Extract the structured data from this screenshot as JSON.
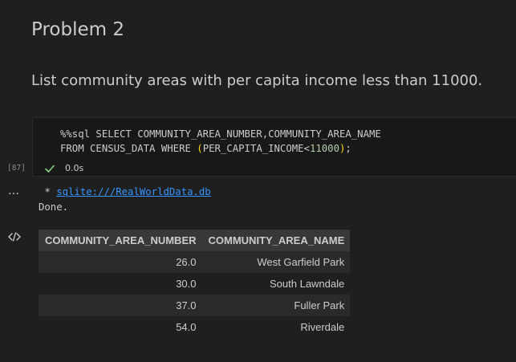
{
  "markdown": {
    "heading": "Problem 2",
    "paragraph": "List community areas with per capita income less than 11000."
  },
  "code_cell": {
    "line1": "%%sql SELECT COMMUNITY_AREA_NUMBER,COMMUNITY_AREA_NAME",
    "line2_prefix": "FROM CENSUS_DATA WHERE ",
    "line2_paren_open": "(",
    "line2_cond": "PER_CAPITA_INCOME<",
    "line2_number": "11000",
    "line2_paren_close": ")",
    "line2_end": ";",
    "execution_count": "[87]",
    "exec_time": "0.0s"
  },
  "output": {
    "more_icon": "…",
    "star_prefix": " * ",
    "db_link": "sqlite:///RealWorldData.db",
    "done_text": "Done.",
    "table": {
      "headers": [
        "COMMUNITY_AREA_NUMBER",
        "COMMUNITY_AREA_NAME"
      ],
      "rows": [
        [
          "26.0",
          "West Garfield Park"
        ],
        [
          "30.0",
          "South Lawndale"
        ],
        [
          "37.0",
          "Fuller Park"
        ],
        [
          "54.0",
          "Riverdale"
        ]
      ]
    }
  },
  "colors": {
    "background": "#1f1f1f",
    "code_background": "#181818",
    "link": "#3794ff",
    "check": "#89d185",
    "number": "#b5cea8",
    "paren": "#ffd700"
  },
  "icons": {
    "check": "check-icon",
    "more": "more-icon",
    "output_code": "code-icon"
  }
}
